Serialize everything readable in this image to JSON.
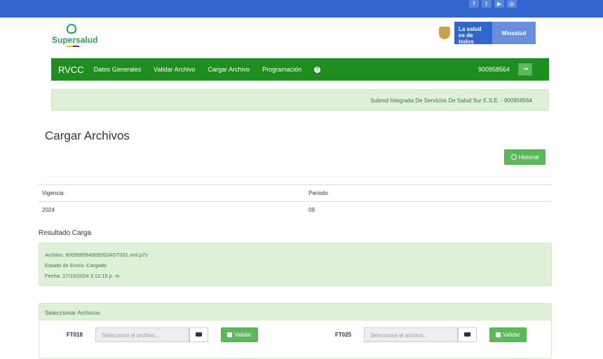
{
  "social": {
    "icons": [
      "f",
      "t",
      "▶",
      "◎"
    ]
  },
  "brand": {
    "name": "Supersalud"
  },
  "gov": {
    "slogan_line1": "La salud",
    "slogan_line2": "es de todos",
    "ministry": "Minsalud"
  },
  "navbar": {
    "brand": "RVCC",
    "items": [
      "Datos Generales",
      "Validar Archivo",
      "Cargar Archivo",
      "Programación"
    ],
    "help": "?",
    "nit": "900958564",
    "logout": "⇥"
  },
  "entity": {
    "text": "Subred Integrada De Servicios De Salud Sur E.S.E. - 900958564"
  },
  "page": {
    "title": "Cargar Archivos",
    "history_label": "Historial"
  },
  "table": {
    "headers": [
      "Vigencia",
      "Periodo"
    ],
    "values": [
      "2024",
      "09"
    ]
  },
  "result": {
    "title": "Resultado Carga",
    "file": "Archivo: 9009585649092024GT001.xml.p7z",
    "status": "Estado de Envío: Cargado",
    "date": "Fecha: 17/10/2024 3:12:15 p. m."
  },
  "files": {
    "panel_title": "Seleccionar Archivos",
    "rows": [
      {
        "code": "FT018",
        "placeholder": "Seleccione el archivo...",
        "button": "Validar"
      },
      {
        "code": "FT025",
        "placeholder": "Seleccione el archivo...",
        "button": "Validar"
      }
    ]
  }
}
